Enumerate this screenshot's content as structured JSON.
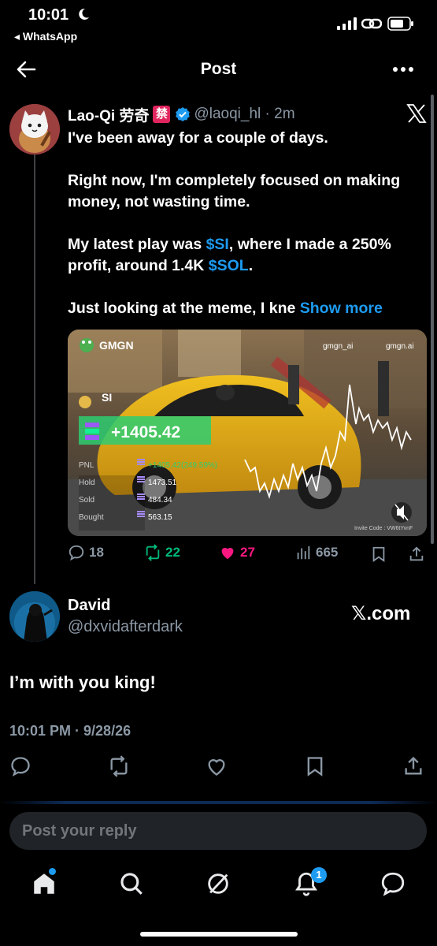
{
  "status_bar": {
    "time": "10:01",
    "back_app": "◂ WhatsApp"
  },
  "header": {
    "title": "Post"
  },
  "post": {
    "author_name": "Lao-Qi 劳奇",
    "author_flag": "禁",
    "handle_time": "@laoqi_hl · 2m",
    "paragraphs": [
      "I've been away for a couple of days.",
      "Right now, I'm completely focused on making money, not wasting time."
    ],
    "p3_before": "My latest play was ",
    "p3_tag1": "$SI",
    "p3_mid": ", where I made a 250% profit, around 1.4K ",
    "p3_tag2": "$SOL",
    "p3_after": ".",
    "p4_text": "Just looking at the meme, I kne ",
    "show_more": "Show more",
    "media": {
      "brand": "GMGN",
      "x_handle": "gmgn_ai",
      "site": "gmgn.ai",
      "token": "SI",
      "pnl_big": "+1405.42",
      "rows": [
        {
          "label": "PNL",
          "value": "+1405.42(249.59%)"
        },
        {
          "label": "Hold",
          "value": "1473.51"
        },
        {
          "label": "Sold",
          "value": "484.34"
        },
        {
          "label": "Bought",
          "value": "563.15"
        }
      ],
      "invite": "Invite Code : VW6tYvnF"
    },
    "stats": {
      "replies": "18",
      "reposts": "22",
      "likes": "27",
      "views": "665"
    }
  },
  "reply": {
    "name": "David",
    "handle": "@dxvidafterdark",
    "link_card": "𝕏.com",
    "text": "I’m with you king!",
    "timestamp": "10:01 PM · 9/28/26"
  },
  "composer": {
    "placeholder": "Post your reply"
  },
  "nav": {
    "notifications_badge": "1"
  },
  "colors": {
    "accent": "#1d9bf0",
    "repost": "#00ba7c",
    "like": "#f91880",
    "muted": "#8b98a5"
  }
}
